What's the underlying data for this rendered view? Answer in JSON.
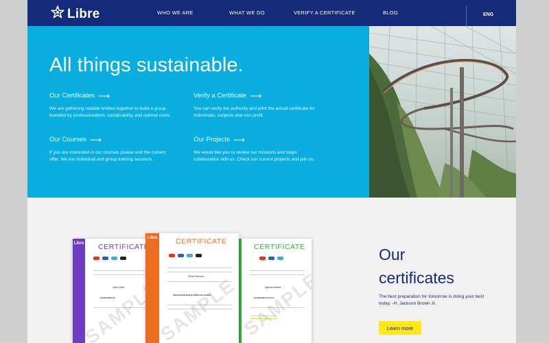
{
  "colors": {
    "header": "#152a7a",
    "hero": "#0aaede",
    "accent_yellow": "#ffe81a",
    "cert_purple": "#6e3cbf",
    "cert_orange": "#ec6d1f",
    "cert_green": "#2fae3a"
  },
  "header": {
    "logo_text": "Libre",
    "logo_icon": "star-icon",
    "nav": [
      {
        "label": "WHO WE ARE"
      },
      {
        "label": "WHAT WE DO"
      },
      {
        "label": "VERIFY A CERTIFICATE"
      },
      {
        "label": "BLOG"
      }
    ],
    "language": "ENG"
  },
  "hero": {
    "title": "All things sustainable.",
    "features": [
      {
        "title": "Our Certificates",
        "text": "We are gathering reliable entities together to build a group branded by professionalism, sustainability and optimal costs."
      },
      {
        "title": "Verify a Certificate",
        "text": "You can verify the authority and print the actual certificate for individuals, subjects and non profit."
      },
      {
        "title": "Our Courses",
        "text": "If you are interested in our courses please visit the current offer. We run individual and group training sessions."
      },
      {
        "title": "Our Projects",
        "text": "We would like you to review our missions and begin collaboration with us. Check our current projects and join us."
      }
    ],
    "arrow": "⟶"
  },
  "certificates": {
    "heading_line1": "Our",
    "heading_line2": "certificates",
    "quote": "The best preparation for tomorrow is doing your best today. -H. Jackson Brown Jr.",
    "button": "Learn more",
    "cards": [
      {
        "title": "CERTIFICATE",
        "brand": "Libre",
        "watermark": "SAMPLE",
        "name": "John Doe",
        "course": "Sustainable Art"
      },
      {
        "title": "CERTIFICATE",
        "brand": "Libre",
        "watermark": "SAMPLE",
        "name": "Piotr Kokosa",
        "course": "International Energy Efficiency Auditor"
      },
      {
        "title": "CERTIFICATE",
        "brand": "",
        "watermark": "SAMPLE",
        "name": "Agroschemie",
        "course": "Sustainable Courses"
      }
    ]
  }
}
